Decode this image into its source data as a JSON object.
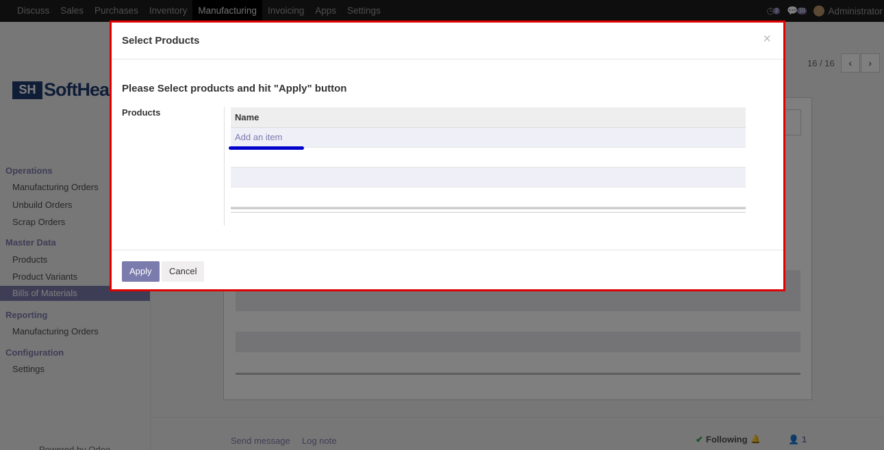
{
  "topbar": {
    "menu": [
      "Discuss",
      "Sales",
      "Purchases",
      "Inventory",
      "Manufacturing",
      "Invoicing",
      "Apps",
      "Settings"
    ],
    "active_index": 4,
    "activity_count": "2",
    "messages_count": "10",
    "user": "Administrator"
  },
  "pager": {
    "value": "16 / 16"
  },
  "sidebar": {
    "logo_text": "SoftHea",
    "logo_mark": "SH",
    "sections": {
      "operations": "Operations",
      "master_data": "Master Data",
      "reporting": "Reporting",
      "configuration": "Configuration"
    },
    "items": {
      "manufacturing_orders": "Manufacturing Orders",
      "unbuild_orders": "Unbuild Orders",
      "scrap_orders": "Scrap Orders",
      "products": "Products",
      "product_variants": "Product Variants",
      "bills_of_materials": "Bills of Materials",
      "reporting_manufacturing_orders": "Manufacturing Orders",
      "settings": "Settings"
    },
    "powered_by": "Powered by Odoo"
  },
  "chatter": {
    "send_message": "Send message",
    "log_note": "Log note",
    "following": "Following",
    "followers": "1"
  },
  "modal": {
    "title": "Select Products",
    "close": "×",
    "instruction": "Please Select products and hit \"Apply\" button",
    "field_label": "Products",
    "column_name": "Name",
    "add_item": "Add an item",
    "apply_label": "Apply",
    "cancel_label": "Cancel"
  },
  "colors": {
    "accent": "#7c7bad",
    "highlight_border": "#e00000",
    "annotation_underline": "#0000cc"
  }
}
